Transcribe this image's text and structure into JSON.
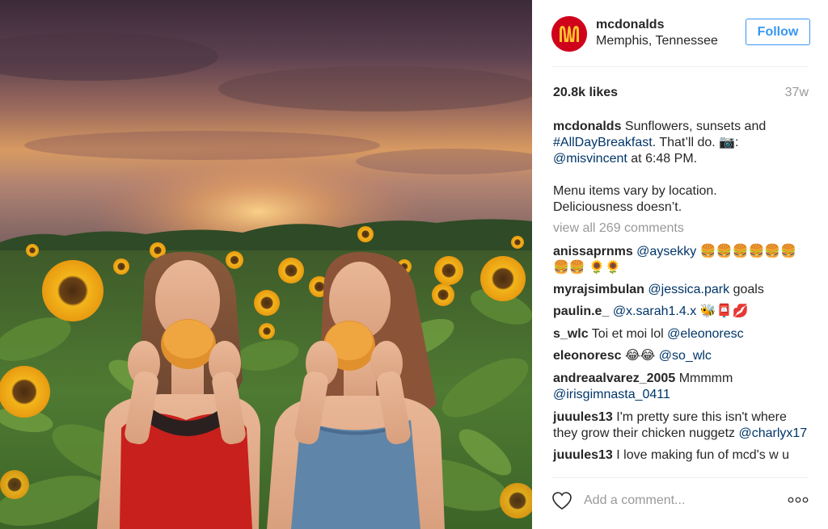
{
  "post": {
    "username": "mcdonalds",
    "location": "Memphis, Tennessee",
    "follow_label": "Follow",
    "likes": "20.8k likes",
    "time_ago": "37w",
    "caption_part1": "Sunflowers, sunsets and",
    "caption_hashtag": "#AllDayBreakfast",
    "caption_part2": ". That’ll do. 📷:",
    "caption_mention": "@misvincent",
    "caption_part3": " at 6:48 PM.",
    "caption_para2": "Menu items vary by location. Deliciousness doesn’t.",
    "view_all": "view all 269 comments"
  },
  "comments": [
    {
      "user": "anissaprnms",
      "mention": "@aysekky",
      "text": "🍔🍔🍔🍔🍔🍔🍔🍔 🌻🌻"
    },
    {
      "user": "myrajsimbulan",
      "mention": "@jessica.park",
      "text": "goals"
    },
    {
      "user": "paulin.e_",
      "mention": "@x.sarah1.4.x",
      "text": "🐝📮💋"
    },
    {
      "user": "s_wlc",
      "text": "Toi et moi lol",
      "mention": "@eleonoresc"
    },
    {
      "user": "eleonoresc",
      "text": "😂😂",
      "mention": "@so_wlc"
    },
    {
      "user": "andreaalvarez_2005",
      "text": "Mmmmm",
      "mention": "@irisgimnasta_0411"
    },
    {
      "user": "juuules13",
      "text": "I'm pretty sure this isn't where they grow their chicken nuggetz",
      "mention": "@charlyx17"
    },
    {
      "user": "juuules13",
      "text": "I love making fun of mcd's w u"
    }
  ],
  "footer": {
    "add_comment_placeholder": "Add a comment..."
  },
  "colors": {
    "link": "#003569",
    "follow_blue": "#3897f0",
    "brand_red": "#d0021b",
    "brand_yellow": "#ffc72c"
  },
  "icons": [
    "mcdonalds-logo-icon",
    "heart-icon",
    "more-options-icon"
  ]
}
